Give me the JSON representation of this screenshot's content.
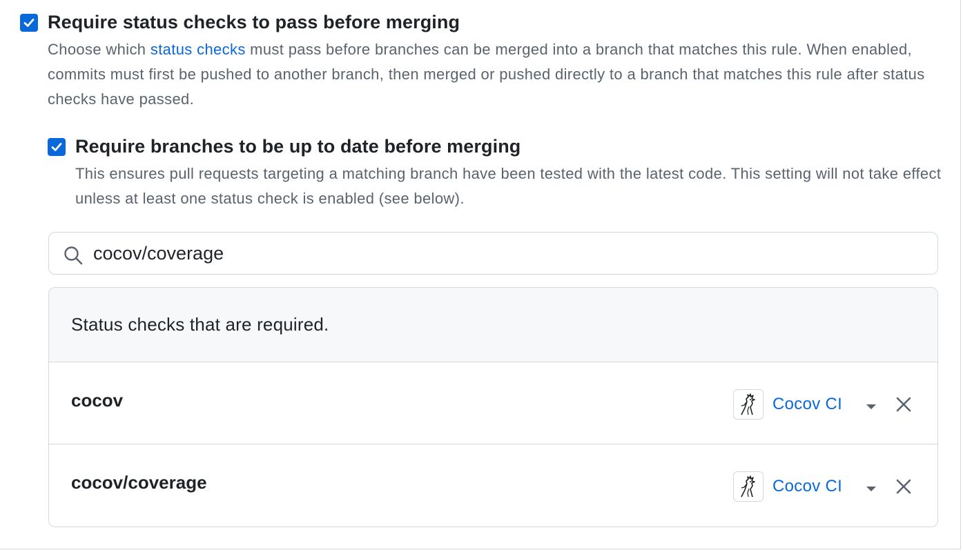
{
  "require_status_checks": {
    "checked": true,
    "title": "Require status checks to pass before merging",
    "description_prefix": "Choose which ",
    "description_link": "status checks",
    "description_suffix": " must pass before branches can be merged into a branch that matches this rule. When enabled, commits must first be pushed to another branch, then merged or pushed directly to a branch that matches this rule after status checks have passed."
  },
  "require_up_to_date": {
    "checked": true,
    "title": "Require branches to be up to date before merging",
    "description": "This ensures pull requests targeting a matching branch have been tested with the latest code. This setting will not take effect unless at least one status check is enabled (see below)."
  },
  "search": {
    "value": "cocov/coverage",
    "icon": "search-icon"
  },
  "checks": {
    "header": "Status checks that are required.",
    "items": [
      {
        "name": "cocov",
        "app": "Cocov CI",
        "app_icon": "cocov-logo-icon"
      },
      {
        "name": "cocov/coverage",
        "app": "Cocov CI",
        "app_icon": "cocov-logo-icon"
      }
    ]
  },
  "colors": {
    "accent": "#0969da",
    "muted_text": "#59636e",
    "border": "#d1d9e0",
    "header_bg": "#f6f8fa"
  }
}
